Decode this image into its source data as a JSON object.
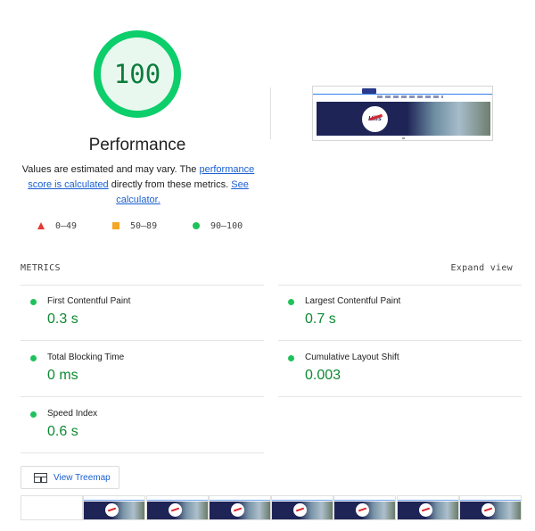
{
  "gauge": {
    "score": "100",
    "title": "Performance",
    "color": "#0cce6b",
    "fill": "#e8f8ee",
    "text_color": "#0c7c3c"
  },
  "description": {
    "prefix": "Values are estimated and may vary. The ",
    "link1": "performance score is calculated",
    "middle": " directly from these metrics. ",
    "link2": "See calculator."
  },
  "final_screenshot": {
    "badge_text": "Hills"
  },
  "legend": [
    {
      "icon": "triangle-icon",
      "label": "0–49",
      "color": "#e53935"
    },
    {
      "icon": "square-icon",
      "label": "50–89",
      "color": "#f5a623"
    },
    {
      "icon": "circle-icon",
      "label": "90–100",
      "color": "#1ec25a"
    }
  ],
  "metrics_section": {
    "heading": "METRICS",
    "expand_label": "Expand view"
  },
  "metrics": [
    {
      "title": "First Contentful Paint",
      "value": "0.3 s"
    },
    {
      "title": "Largest Contentful Paint",
      "value": "0.7 s"
    },
    {
      "title": "Total Blocking Time",
      "value": "0 ms"
    },
    {
      "title": "Cumulative Layout Shift",
      "value": "0.003"
    },
    {
      "title": "Speed Index",
      "value": "0.6 s"
    }
  ],
  "treemap": {
    "label": "View Treemap"
  }
}
